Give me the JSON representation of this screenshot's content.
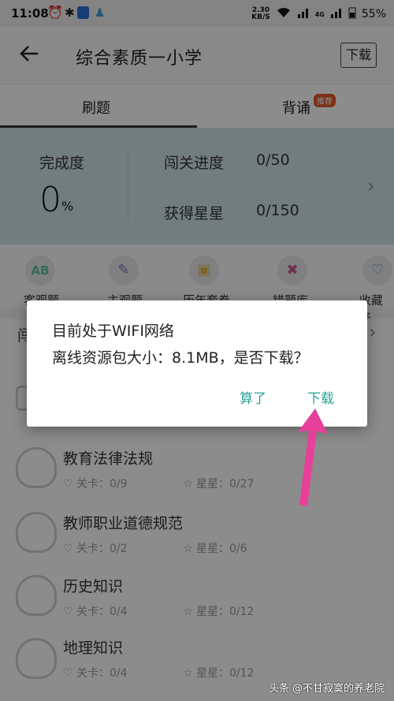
{
  "status_bar": {
    "time": "11:08",
    "net_speed_value": "2.30",
    "net_speed_unit": "KB/S",
    "network_type": "4G",
    "battery": "55%"
  },
  "header": {
    "title": "综合素质一小学",
    "download_label": "下载"
  },
  "tabs": [
    {
      "label": "刷题",
      "active": true
    },
    {
      "label": "背诵",
      "badge": "推荐"
    }
  ],
  "progress": {
    "completion_label": "完成度",
    "completion_value": "0",
    "completion_unit": "%",
    "level_label": "闯关进度",
    "level_value": "0/50",
    "stars_label": "获得星星",
    "stars_value": "0/150"
  },
  "categories": [
    {
      "label": "客观题",
      "icon": "ab-icon",
      "color": "#5fbf9a"
    },
    {
      "label": "主观题",
      "icon": "pencil-icon",
      "color": "#8a6ac2"
    },
    {
      "label": "历年套卷",
      "icon": "envelope-icon",
      "color": "#e0b24a"
    },
    {
      "label": "错题库",
      "icon": "wrong-book-icon",
      "color": "#c05c8a"
    },
    {
      "label": "收藏夹",
      "icon": "folder-heart-icon",
      "color": "#4aa6b8"
    }
  ],
  "section": {
    "title": "闯"
  },
  "list": [
    {
      "title": "教育法律法规",
      "levels": "关卡：0/9",
      "stars": "星星：0/27"
    },
    {
      "title": "教师职业道德规范",
      "levels": "关卡：0/2",
      "stars": "星星：0/6"
    },
    {
      "title": "历史知识",
      "levels": "关卡：0/4",
      "stars": "星星：0/12"
    },
    {
      "title": "地理知识",
      "levels": "关卡：0/4",
      "stars": "星星：0/12"
    }
  ],
  "dialog": {
    "line1": "目前处于WIFI网络",
    "line2": "离线资源包大小：8.1MB，是否下载？",
    "cancel_label": "算了",
    "confirm_label": "下载",
    "accent_color": "#2aa198"
  },
  "annotation": {
    "arrow_color": "#e6409a"
  },
  "watermark": {
    "text": "头条 @不甘寂寞的养老院"
  }
}
